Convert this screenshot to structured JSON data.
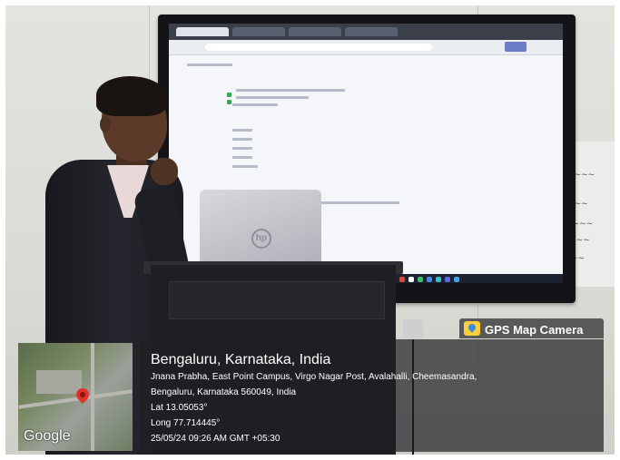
{
  "overlay": {
    "app_label": "GPS Map Camera",
    "map_watermark": "Google",
    "location_title": "Bengaluru, Karnataka, India",
    "address_line_1": "Jnana Prabha, East Point Campus, Virgo Nagar Post, Avalahalli, Cheemasandra,",
    "address_line_2": "Bengaluru, Karnataka 560049, India",
    "latitude": "Lat 13.05053°",
    "longitude": "Long 77.714445°",
    "timestamp": "25/05/24 09:26 AM GMT +05:30"
  },
  "laptop": {
    "logo": "hp"
  },
  "colors": {
    "map_pin": "#e0312a",
    "gps_icon": "#ffcf3a",
    "overlay": "#202024"
  }
}
